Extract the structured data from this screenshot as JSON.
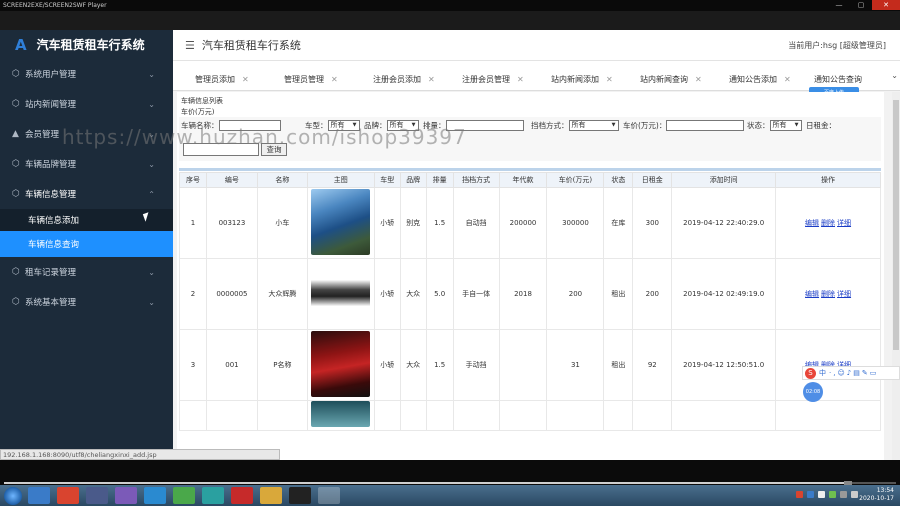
{
  "player": {
    "window_title": "SCREEN2EXE/SCREEN2SWF Player",
    "close_label": "✕",
    "min_label": "—",
    "max_label": "▢"
  },
  "sidebar": {
    "app_title": "汽车租赁租车行系统",
    "logo_glyph": "A",
    "items": [
      {
        "label": "系统用户管理",
        "icon": "cube-icon"
      },
      {
        "label": "站内新闻管理",
        "icon": "cube-icon"
      },
      {
        "label": "会员管理",
        "icon": "user-icon"
      },
      {
        "label": "车辆品牌管理",
        "icon": "cube-icon"
      },
      {
        "label": "车辆信息管理",
        "icon": "cube-icon"
      },
      {
        "label": "租车记录管理",
        "icon": "cube-icon"
      },
      {
        "label": "系统基本管理",
        "icon": "cube-icon"
      }
    ],
    "sub_items": [
      {
        "label": "车辆信息添加"
      },
      {
        "label": "车辆信息查询"
      }
    ]
  },
  "header": {
    "title": "汽车租赁租车行系统",
    "user_info": "当前用户:hsg [超级管理员]"
  },
  "tabs": [
    {
      "label": "管理员添加"
    },
    {
      "label": "管理员管理"
    },
    {
      "label": "注册会员添加"
    },
    {
      "label": "注册会员管理"
    },
    {
      "label": "站内新闻添加"
    },
    {
      "label": "站内新闻查询"
    },
    {
      "label": "通知公告添加"
    },
    {
      "label": "通知公告查询"
    }
  ],
  "baidu_badge": "百度上传",
  "caption": "车辆信息列表",
  "search": {
    "price_line": "车价(万元)",
    "f_name": "车辆名称：",
    "f_type": "车型：",
    "f_type_value": "所有",
    "f_brand": "品牌：",
    "f_brand_value": "所有",
    "f_displacement": "排量：",
    "f_trans": "挡档方式：",
    "f_trans_value": "所有",
    "f_price": "车价(万元)：",
    "f_status": "状态：",
    "f_status_value": "所有",
    "f_rent": "日租金：",
    "button": "查询"
  },
  "table": {
    "headers": [
      "序号",
      "编号",
      "名称",
      "主图",
      "车型",
      "品牌",
      "排量",
      "挡档方式",
      "年代款",
      "车价(万元)",
      "状态",
      "日租金",
      "添加时间",
      "操作"
    ],
    "rows": [
      {
        "no": "1",
        "code": "003123",
        "name": "小车",
        "type": "小轿",
        "brand": "别克",
        "disp": "1.5",
        "trans": "自动挡",
        "year": "200000",
        "price": "300000",
        "status": "在库",
        "rent": "300",
        "time": "2019-04-12 22:40:29.0",
        "img": "car-blue"
      },
      {
        "no": "2",
        "code": "0000005",
        "name": "大众辉腾",
        "type": "小轿",
        "brand": "大众",
        "disp": "5.0",
        "trans": "手自一体",
        "year": "2018",
        "price": "200",
        "status": "租出",
        "rent": "200",
        "time": "2019-04-12 02:49:19.0",
        "img": "car-dark"
      },
      {
        "no": "3",
        "code": "001",
        "name": "P名称",
        "type": "小轿",
        "brand": "大众",
        "disp": "1.5",
        "trans": "手动挡",
        "year": "",
        "price": "31",
        "status": "租出",
        "rent": "92",
        "time": "2019-04-12 12:50:51.0",
        "img": "car-red"
      }
    ],
    "ops": [
      "编辑",
      "删除",
      "详细"
    ]
  },
  "ime": {
    "logo": "S",
    "lang": "中",
    "icons": "·,☺♪▤✎▭"
  },
  "timer": "02:08",
  "watermark": "https://www.huzhan.com/ishop39397",
  "status_url": "192.168.1.168:8090/utf8/cheliangxinxi_add.jsp",
  "tray": {
    "time": "13:54",
    "date": "2020-10-17"
  },
  "colors": {
    "sidebar_bg": "#1c2b3a",
    "active_blue": "#1e90ff",
    "link_blue": "#1a3cc6"
  }
}
